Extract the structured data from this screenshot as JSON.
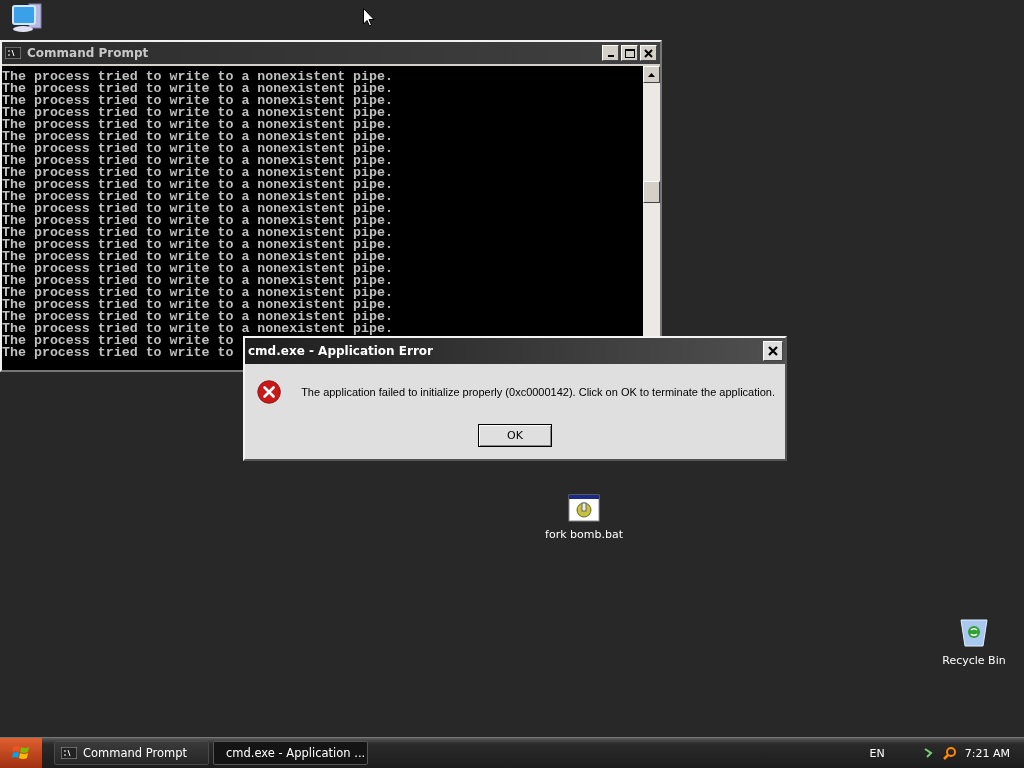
{
  "desktop_icons": [
    {
      "kind": "computer"
    },
    {
      "kind": "batch",
      "label": "fork bomb.bat"
    },
    {
      "kind": "recycle",
      "label": "Recycle Bin"
    }
  ],
  "console": {
    "title": "Command Prompt",
    "lines": [
      "The process tried to write to a nonexistent pipe.",
      "The process tried to write to a nonexistent pipe.",
      "The process tried to write to a nonexistent pipe.",
      "The process tried to write to a nonexistent pipe.",
      "The process tried to write to a nonexistent pipe.",
      "The process tried to write to a nonexistent pipe.",
      "The process tried to write to a nonexistent pipe.",
      "The process tried to write to a nonexistent pipe.",
      "The process tried to write to a nonexistent pipe.",
      "The process tried to write to a nonexistent pipe.",
      "The process tried to write to a nonexistent pipe.",
      "The process tried to write to a nonexistent pipe.",
      "The process tried to write to a nonexistent pipe.",
      "The process tried to write to a nonexistent pipe.",
      "The process tried to write to a nonexistent pipe.",
      "The process tried to write to a nonexistent pipe.",
      "The process tried to write to a nonexistent pipe.",
      "The process tried to write to a nonexistent pipe.",
      "The process tried to write to a nonexistent pipe.",
      "The process tried to write to a nonexistent pipe.",
      "The process tried to write to a nonexistent pipe.",
      "The process tried to write to a nonexistent pipe.",
      "The process tried to write to",
      "The process tried to write to"
    ]
  },
  "dialog": {
    "title": "cmd.exe - Application Error",
    "message": "The application failed to initialize properly (0xc0000142). Click on OK to terminate the application.",
    "button": "OK"
  },
  "taskbar": {
    "items": [
      {
        "kind": "console",
        "label": "Command Prompt",
        "selected": false
      },
      {
        "kind": "window",
        "label": "cmd.exe - Application ...",
        "selected": true
      }
    ],
    "language": "EN",
    "clock": "7:21 AM"
  }
}
